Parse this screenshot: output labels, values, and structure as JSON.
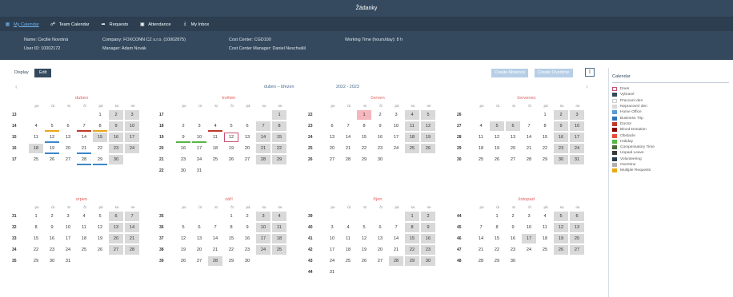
{
  "app": {
    "title": "Žádanky"
  },
  "nav": [
    {
      "label": "My Calendar",
      "icon": "calendar-icon",
      "glyph": "▦",
      "active": true
    },
    {
      "label": "Team Calendar",
      "icon": "team-icon",
      "glyph": "☍",
      "active": false
    },
    {
      "label": "Requests",
      "icon": "requests-icon",
      "glyph": "➦",
      "active": false
    },
    {
      "label": "Attendance",
      "icon": "attendance-icon",
      "glyph": "▣",
      "active": false
    },
    {
      "label": "My Inbox",
      "icon": "inbox-icon",
      "glyph": "⤓",
      "active": false
    }
  ],
  "info": {
    "name": "Name: Cecilie Novotná",
    "user_id": "User ID: 10002172",
    "company": "Company: FOXCONN CZ s.r.o. (10002875)",
    "manager": "Manager: Adam Novák",
    "cost_center": "Cost Center: CGD100",
    "cc_manager": "Cost Center Manager: Daniel Neschválil",
    "working_time": "Working Time (hours/day): 8 h"
  },
  "toolbar": {
    "display": "Display",
    "edit": "Edit",
    "create_absence": "Create Absence",
    "create_overtime": "Create Overtime",
    "calendar_icon_glyph": "▯"
  },
  "period": {
    "range": "duben – březen",
    "years": "2022 - 2023",
    "prev": "‹",
    "next": "›"
  },
  "dow": [
    "po",
    "út",
    "st",
    "čt",
    "pá",
    "so",
    "ne"
  ],
  "months": [
    {
      "name": "duben",
      "first": 4,
      "days": 30,
      "weeks": [
        "13",
        "14",
        "15",
        "16",
        "17"
      ],
      "holidays": [
        15,
        18
      ],
      "marks": {
        "5": "#e6a817",
        "7": "#c0392b",
        "8": "#e6a817",
        "12": "#3b87c8",
        "19": "#3b87c8",
        "21": "#3b87c8",
        "28": "#3b87c8",
        "29": "#3b87c8"
      }
    },
    {
      "name": "květen",
      "first": 6,
      "days": 31,
      "weeks": [
        "17",
        "18",
        "19",
        "20",
        "21",
        "22"
      ],
      "holidays": [
        1,
        8
      ],
      "today": 12,
      "marks": {
        "4": "#c0392b",
        "9": "#5ab547",
        "10": "#5ab547"
      }
    },
    {
      "name": "červen",
      "first": 2,
      "days": 30,
      "weeks": [
        "22",
        "23",
        "24",
        "25",
        "26"
      ],
      "holidays": [],
      "sel": [
        1
      ],
      "marks": {}
    },
    {
      "name": "červenec",
      "first": 4,
      "days": 31,
      "weeks": [
        "26",
        "27",
        "28",
        "29",
        "30"
      ],
      "holidays": [
        5,
        6
      ],
      "marks": {}
    },
    {
      "name": "srpen",
      "first": 0,
      "days": 31,
      "weeks": [
        "31",
        "32",
        "33",
        "34",
        "35"
      ],
      "holidays": [],
      "marks": {}
    },
    {
      "name": "září",
      "first": 3,
      "days": 30,
      "weeks": [
        "35",
        "36",
        "37",
        "38",
        "39"
      ],
      "holidays": [
        28
      ],
      "marks": {}
    },
    {
      "name": "říjen",
      "first": 5,
      "days": 31,
      "weeks": [
        "39",
        "40",
        "41",
        "42",
        "43",
        "44"
      ],
      "holidays": [
        28
      ],
      "marks": {}
    },
    {
      "name": "listopad",
      "first": 1,
      "days": 30,
      "weeks": [
        "44",
        "45",
        "46",
        "47",
        "48"
      ],
      "holidays": [
        17
      ],
      "marks": {}
    }
  ],
  "legend": {
    "title": "Calendar",
    "items": [
      {
        "label": "Dnes",
        "color": "#ffffff",
        "border": "#c94f73"
      },
      {
        "label": "Vybrané",
        "color": "#34495e"
      },
      {
        "label": "Pracovní den",
        "color": "#ffffff",
        "border": "#cccccc"
      },
      {
        "label": "Nepracovní den",
        "color": "#d9d9d9"
      },
      {
        "label": "Home Office",
        "color": "#5b9bd5"
      },
      {
        "label": "Business Trip",
        "color": "#2e75b6"
      },
      {
        "label": "Doctor",
        "color": "#c0392b"
      },
      {
        "label": "Blood Donation",
        "color": "#8b0000"
      },
      {
        "label": "Obstacle",
        "color": "#e74c3c"
      },
      {
        "label": "Holiday",
        "color": "#5ab547"
      },
      {
        "label": "Compensatory Time",
        "color": "#4a6b3a"
      },
      {
        "label": "Unpaid Leave",
        "color": "#3a3a3a"
      },
      {
        "label": "Volunteering",
        "color": "#2c3e50"
      },
      {
        "label": "Overtime",
        "color": "#b0b0b0"
      },
      {
        "label": "Multiple Requests",
        "color": "#e6a817"
      }
    ]
  }
}
